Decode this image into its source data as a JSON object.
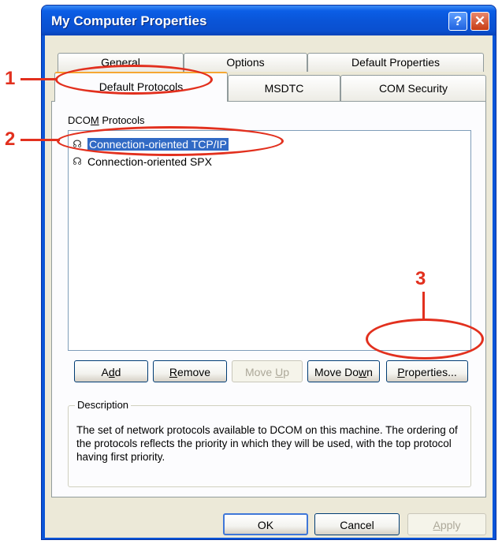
{
  "window": {
    "title": "My Computer Properties",
    "help_glyph": "?",
    "close_glyph": "✕"
  },
  "tabs": {
    "row1": [
      "General",
      "Options",
      "Default Properties"
    ],
    "row2": [
      "Default Protocols",
      "MSDTC",
      "COM Security"
    ],
    "active": "Default Protocols"
  },
  "panel": {
    "list_label": "DCOM Protocols",
    "list_label_access_key": "M",
    "protocols": [
      {
        "label": "Connection-oriented TCP/IP",
        "selected": true,
        "icon": "protocol-icon"
      },
      {
        "label": "Connection-oriented SPX",
        "selected": false,
        "icon": "protocol-icon"
      }
    ],
    "buttons": {
      "add": "Add",
      "remove": "Remove",
      "move_up": "Move Up",
      "move_down": "Move Down",
      "properties": "Properties..."
    },
    "description_title": "Description",
    "description_text": "The set of network protocols available to DCOM on this machine. The ordering of the protocols reflects the priority in which they will be used, with the top protocol having first priority."
  },
  "footer": {
    "ok": "OK",
    "cancel": "Cancel",
    "apply": "Apply"
  },
  "annotations": {
    "markers": [
      "1",
      "2",
      "3"
    ],
    "color": "#e2301e"
  },
  "colors": {
    "titlebar": "#0a55d8",
    "dialog_bg": "#ece9d8",
    "selection": "#316ac5",
    "active_tab_accent": "#f6a733"
  }
}
